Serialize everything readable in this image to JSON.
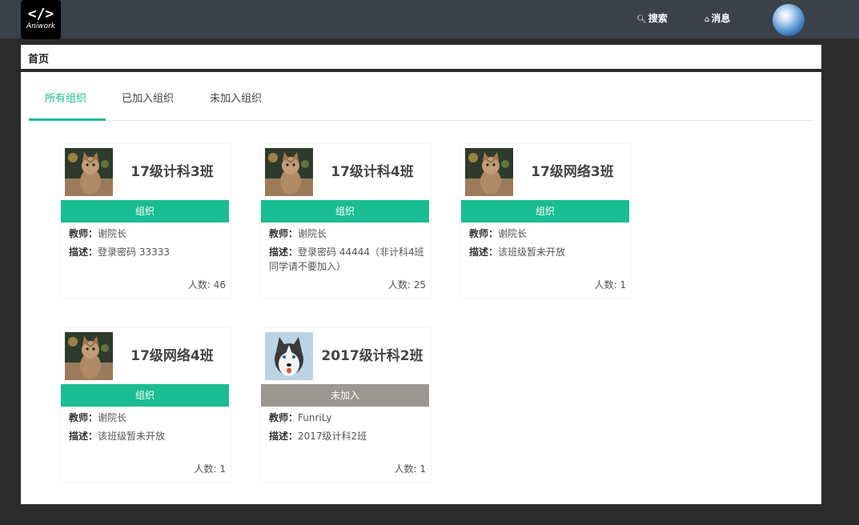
{
  "header": {
    "logo_text": "</>",
    "logo_word": "Aniwork",
    "search_label": "搜索",
    "message_label": "消息"
  },
  "breadcrumb": {
    "label": "首页"
  },
  "tabs": [
    {
      "label": "所有组织",
      "active": true
    },
    {
      "label": "已加入组织",
      "active": false
    },
    {
      "label": "未加入组织",
      "active": false
    }
  ],
  "labels": {
    "teacher": "教师：",
    "description": "描述：",
    "member_prefix": "人数: "
  },
  "cards": [
    {
      "title": "17级计科3班",
      "status": "组织",
      "teacher": "谢院长",
      "description": "登录密码 33333",
      "member_count": "46",
      "image": "cat"
    },
    {
      "title": "17级计科4班",
      "status": "组织",
      "teacher": "谢院长",
      "description": "登录密码 44444（非计科4班同学请不要加入）",
      "member_count": "25",
      "image": "cat"
    },
    {
      "title": "17级网络3班",
      "status": "组织",
      "teacher": "谢院长",
      "description": "该班级暂未开放",
      "member_count": "1",
      "image": "cat"
    },
    {
      "title": "17级网络4班",
      "status": "组织",
      "teacher": "谢院长",
      "description": "该班级暂未开放",
      "member_count": "1",
      "image": "cat"
    },
    {
      "title": "2017级计科2班",
      "status": "未加入",
      "teacher": "FunriLy",
      "description": "2017级计科2班",
      "member_count": "1",
      "image": "husky"
    }
  ],
  "colors": {
    "accent": "#1dbb91",
    "joined_bar": "#1abc93",
    "not_joined_bar": "#9b9791",
    "topbar": "#3b4149"
  }
}
